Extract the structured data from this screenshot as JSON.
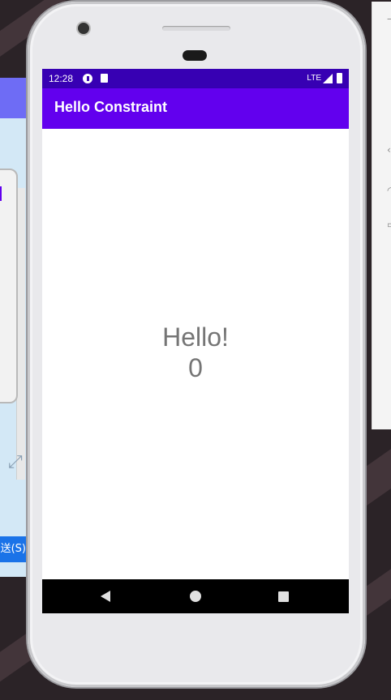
{
  "status_bar": {
    "time": "12:28",
    "network": "LTE"
  },
  "app_bar": {
    "title": "Hello Constraint"
  },
  "content": {
    "greeting": "Hello!",
    "count": "0"
  },
  "background_window": {
    "send_button_label": "送(S)"
  },
  "colors": {
    "status_bar": "#3700b3",
    "app_bar": "#6200ee",
    "text_gray": "#757575",
    "nav_bar": "#000000"
  },
  "icons": {
    "nav_back": "back-triangle-icon",
    "nav_home": "home-circle-icon",
    "nav_recent": "recents-square-icon"
  }
}
